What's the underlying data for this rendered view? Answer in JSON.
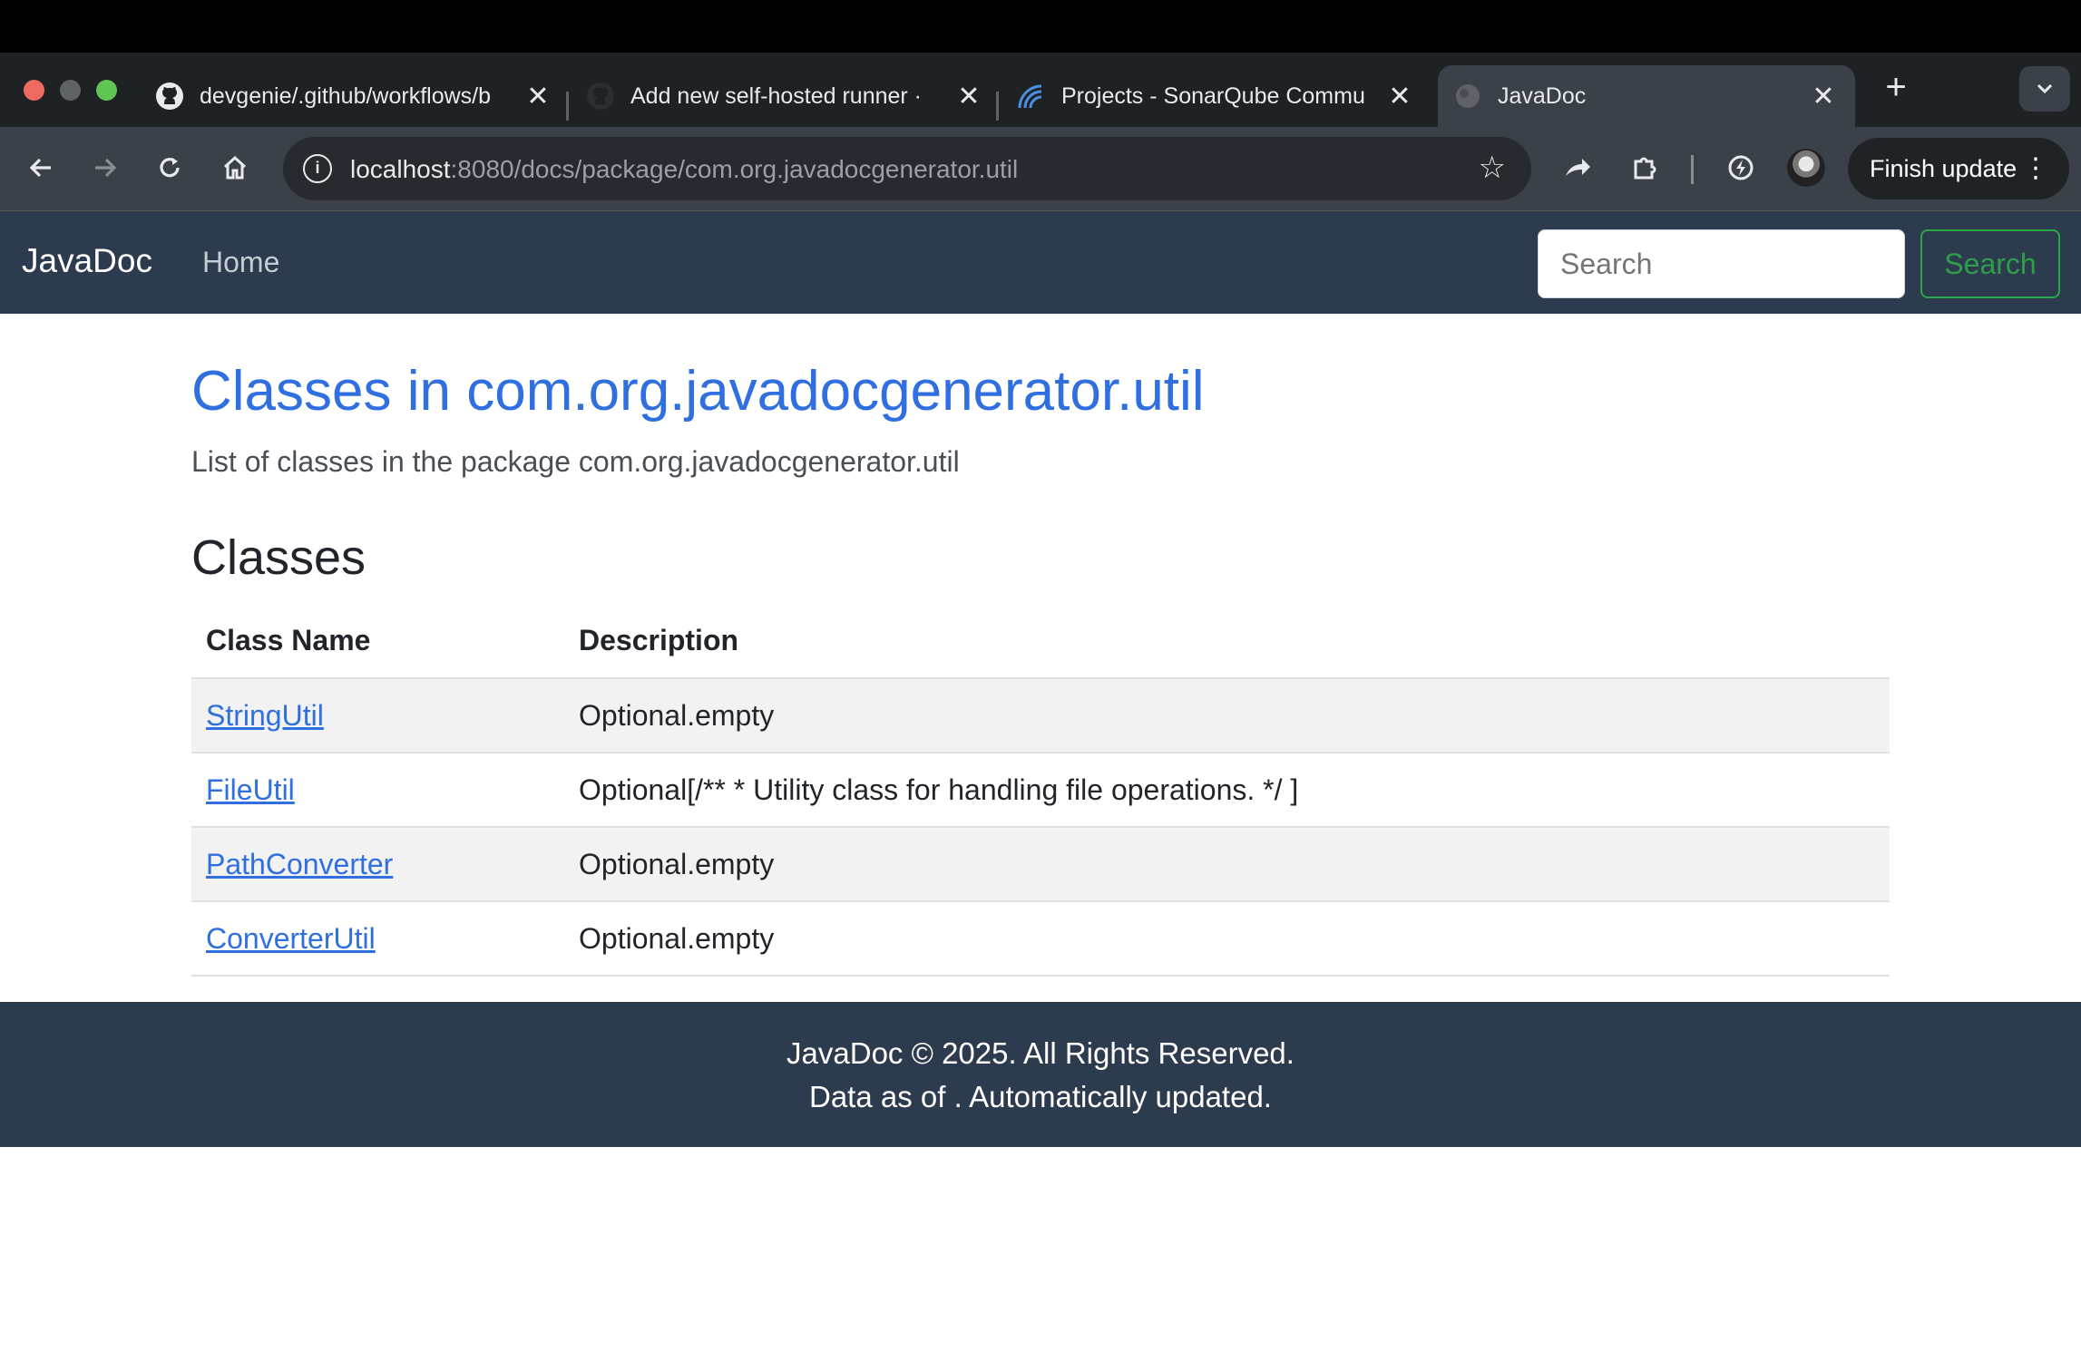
{
  "browser": {
    "tabs": [
      {
        "label": "devgenie/.github/workflows/b",
        "icon": "github-icon"
      },
      {
        "label": "Add new self-hosted runner ·",
        "icon": "github-icon"
      },
      {
        "label": "Projects - SonarQube Commu",
        "icon": "sonarqube-icon"
      },
      {
        "label": "JavaDoc",
        "icon": "globe-icon",
        "active": true
      }
    ],
    "url_host": "localhost",
    "url_rest": ":8080/docs/package/com.org.javadocgenerator.util",
    "finish_update_label": "Finish update"
  },
  "navbar": {
    "brand": "JavaDoc",
    "home_link": "Home",
    "search_placeholder": "Search",
    "search_button": "Search"
  },
  "main": {
    "title": "Classes in com.org.javadocgenerator.util",
    "subtitle": "List of classes in the package com.org.javadocgenerator.util",
    "section_title": "Classes",
    "table": {
      "headers": [
        "Class Name",
        "Description"
      ],
      "rows": [
        {
          "name": "StringUtil",
          "description": "Optional.empty"
        },
        {
          "name": "FileUtil",
          "description": "Optional[/** * Utility class for handling file operations. */ ]"
        },
        {
          "name": "PathConverter",
          "description": "Optional.empty"
        },
        {
          "name": "ConverterUtil",
          "description": "Optional.empty"
        }
      ]
    }
  },
  "footer": {
    "line1": "JavaDoc © 2025. All Rights Reserved.",
    "line2": "Data as of . Automatically updated."
  },
  "colors": {
    "navbar_bg": "#2d3b4e",
    "link": "#2f6fdf",
    "search_button": "#28a745",
    "row_stripe": "#f2f2f2"
  }
}
